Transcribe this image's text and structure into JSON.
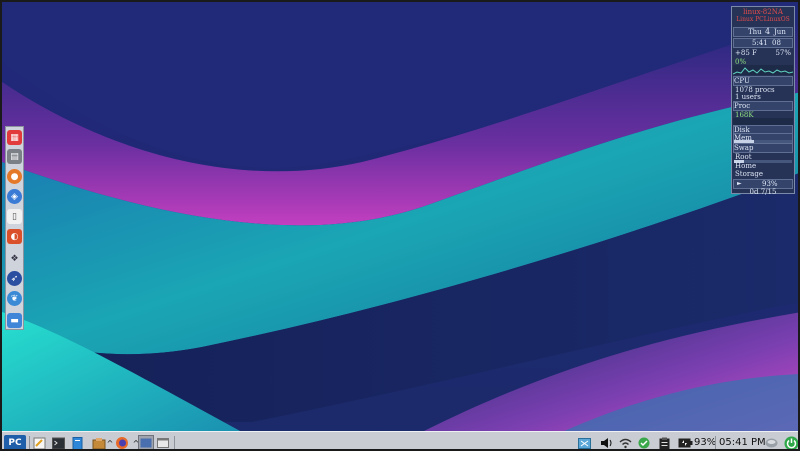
{
  "conky": {
    "hostname": "linux-82NA",
    "subtitle": "Linux PCLinuxOS",
    "day": "Thu",
    "date_num": "4",
    "month": "Jun",
    "time": "5:41",
    "seconds": "08",
    "temp": "+85 F",
    "battery": "57%",
    "cpu_pct": "0%",
    "cpu_label": "CPU",
    "procs": "1078 procs",
    "users": "1 users",
    "proc_label": "Proc",
    "net": "168K",
    "disk_label": "Disk",
    "mem_label": "Mem",
    "swap_label": "Swap",
    "fs": [
      "Root",
      "Home",
      "Storage"
    ],
    "bat_pct": "93%",
    "uptime": "0d  7/15"
  },
  "dock": {
    "icons": [
      "app-grid-icon",
      "calculator-icon",
      "firefox-icon",
      "compass-icon",
      "document-icon",
      "paint-icon",
      "settings-icon",
      "rocket-icon",
      "bird-icon",
      "folder-icon"
    ]
  },
  "taskbar": {
    "start_label": "PC",
    "apps": [
      "text-editor-icon",
      "terminal-icon",
      "file-manager-icon",
      "package-manager-icon",
      "firefox-icon"
    ],
    "windows": [
      "window-thumb-1",
      "window-thumb-2"
    ],
    "tray": {
      "battery_pct": "93%",
      "clock": "05:41 PM"
    }
  },
  "colors": {
    "accent": "#1f5ea8",
    "taskbar": "#c9ccd2",
    "wall_top": "#1f2a7a",
    "wall_magenta": "#c43fc4",
    "wall_teal": "#1fbfb8"
  }
}
